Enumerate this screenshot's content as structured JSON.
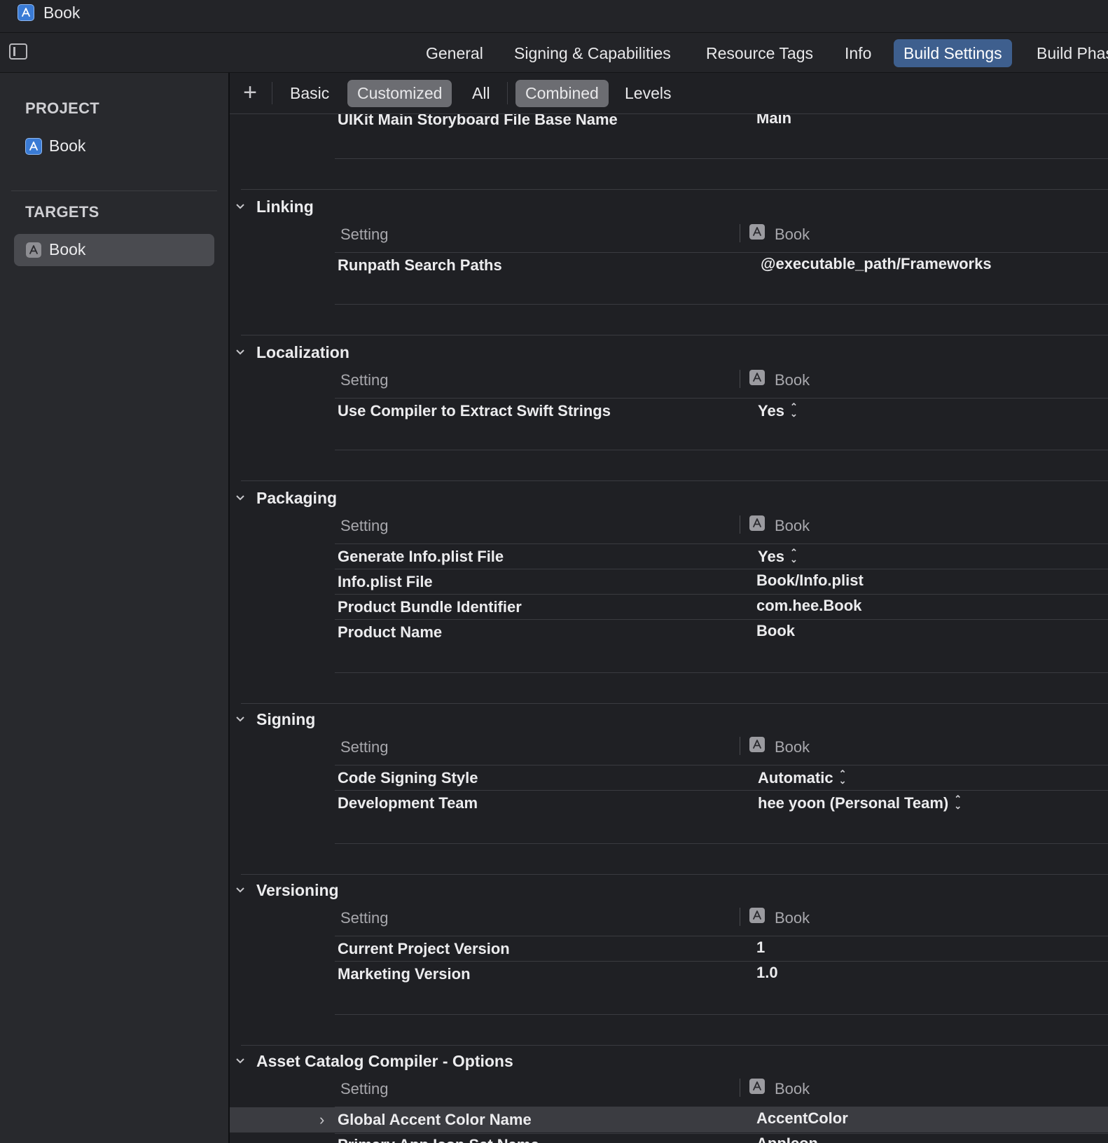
{
  "window": {
    "title": "Book"
  },
  "tabs": [
    "General",
    "Signing & Capabilities",
    "Resource Tags",
    "Info",
    "Build Settings",
    "Build Phas"
  ],
  "sidebar": {
    "project_header": "PROJECT",
    "project_item": "Book",
    "targets_header": "TARGETS",
    "target_item": "Book"
  },
  "filter": {
    "add": "+",
    "basic": "Basic",
    "customized": "Customized",
    "all": "All",
    "combined": "Combined",
    "levels": "Levels"
  },
  "columns": {
    "setting": "Setting",
    "target": "Book"
  },
  "partial_row": {
    "name": "UIKit Main Storyboard File Base Name",
    "value": "Main"
  },
  "sections": [
    {
      "title": "Linking",
      "rows": [
        {
          "name": "Runpath Search Paths",
          "value": "@executable_path/Frameworks"
        }
      ]
    },
    {
      "title": "Localization",
      "rows": [
        {
          "name": "Use Compiler to Extract Swift Strings",
          "value": "Yes"
        }
      ]
    },
    {
      "title": "Packaging",
      "rows": [
        {
          "name": "Generate Info.plist File",
          "value": "Yes"
        },
        {
          "name": "Info.plist File",
          "value": "Book/Info.plist"
        },
        {
          "name": "Product Bundle Identifier",
          "value": "com.hee.Book"
        },
        {
          "name": "Product Name",
          "value": "Book"
        }
      ]
    },
    {
      "title": "Signing",
      "rows": [
        {
          "name": "Code Signing Style",
          "value": "Automatic"
        },
        {
          "name": "Development Team",
          "value": "hee yoon (Personal Team)"
        }
      ]
    },
    {
      "title": "Versioning",
      "rows": [
        {
          "name": "Current Project Version",
          "value": "1"
        },
        {
          "name": "Marketing Version",
          "value": "1.0"
        }
      ]
    },
    {
      "title": "Asset Catalog Compiler - Options",
      "rows": [
        {
          "name": "Global Accent Color Name",
          "value": "AccentColor"
        },
        {
          "name": "Primary App Icon Set Name",
          "value": "AppIcon"
        }
      ]
    }
  ],
  "colors": {
    "accent": "#3e5f8e",
    "background": "#1f2024",
    "sidebar": "#28292d"
  },
  "icons": {
    "app": "xcode-app-icon",
    "sidebar_toggle": "sidebar-toggle-icon",
    "chevron": "chevron-down-icon",
    "updown": "up-down-chevron-icon"
  }
}
